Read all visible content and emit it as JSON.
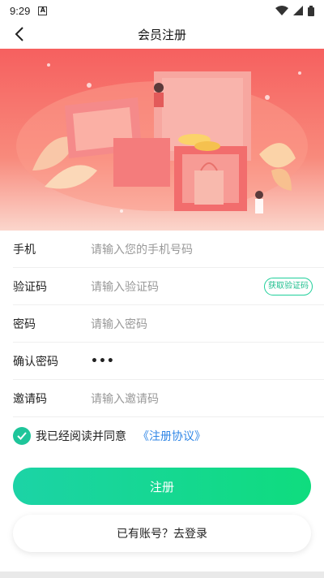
{
  "status_bar": {
    "time": "9:29",
    "notification_glyph": "A"
  },
  "nav": {
    "title": "会员注册"
  },
  "form": {
    "phone": {
      "label": "手机",
      "placeholder": "请输入您的手机号码"
    },
    "code": {
      "label": "验证码",
      "placeholder": "请输入验证码",
      "button": "获取验证码"
    },
    "password": {
      "label": "密码",
      "placeholder": "请输入密码"
    },
    "confirm": {
      "label": "确认密码",
      "value": "•••"
    },
    "invite": {
      "label": "邀请码",
      "placeholder": "请输入邀请码"
    }
  },
  "agreement": {
    "text": "我已经阅读并同意",
    "link": "《注册协议》",
    "checked": true
  },
  "buttons": {
    "register": "注册",
    "login": "已有账号？去登录"
  },
  "colors": {
    "accent_green": "#1ec59a",
    "link_blue": "#2f86e6",
    "banner_red": "#f46a6a"
  }
}
